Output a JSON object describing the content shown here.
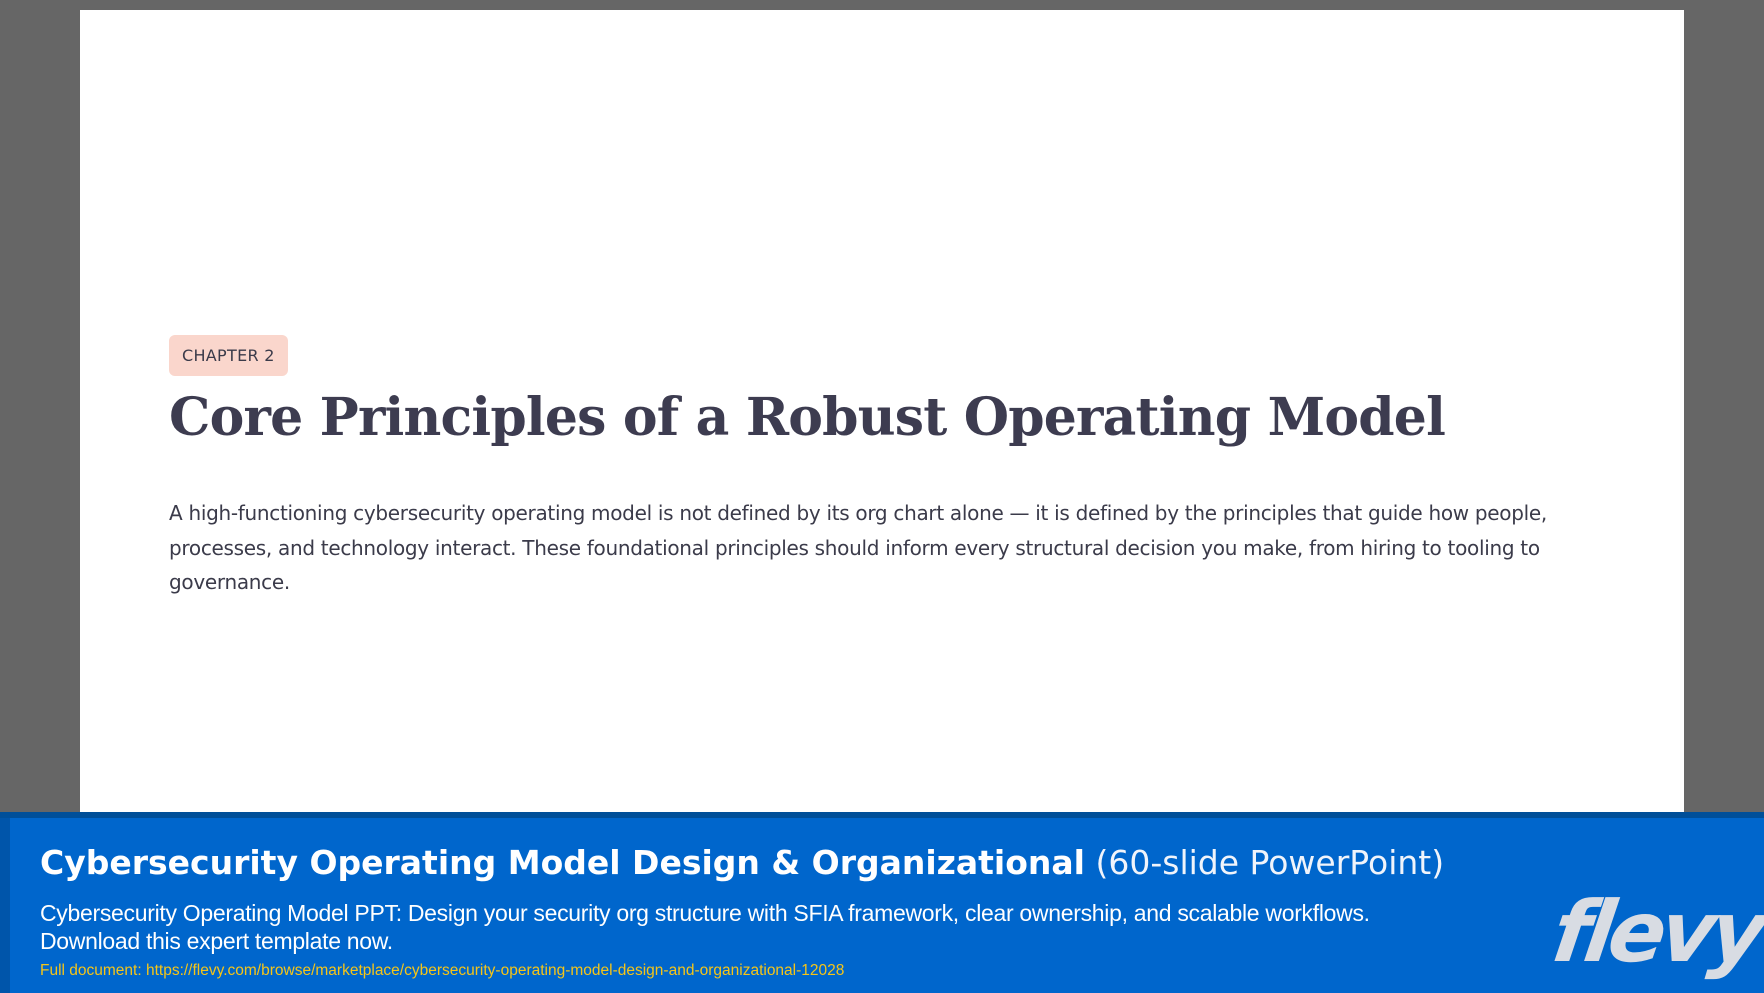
{
  "slide": {
    "chapter_label": "CHAPTER 2",
    "title": "Core Principles of a Robust Operating Model",
    "body": "A high-functioning cybersecurity operating model is not defined by its org chart alone — it is defined by the principles that guide how people, processes, and technology interact. These foundational principles should inform every structural decision you make, from hiring to tooling to governance."
  },
  "footer": {
    "title_main": "Cybersecurity Operating Model Design & Organizational",
    "title_sub": " (60-slide PowerPoint)",
    "description": "Cybersecurity Operating Model PPT: Design your security org structure with SFIA framework, clear ownership, and scalable workflows. Download this expert template now.",
    "link_prefix": "Full document: ",
    "link_url": "https://flevy.com/browse/marketplace/cybersecurity-operating-model-design-and-organizational-12028",
    "logo_text": "flevy"
  },
  "colors": {
    "page_background": "#666666",
    "slide_background": "#ffffff",
    "chapter_badge": "#fad6cc",
    "title_text": "#3d3c50",
    "footer_background": "#0066cc",
    "footer_link": "#f5c518",
    "logo": "#d8dce3"
  }
}
